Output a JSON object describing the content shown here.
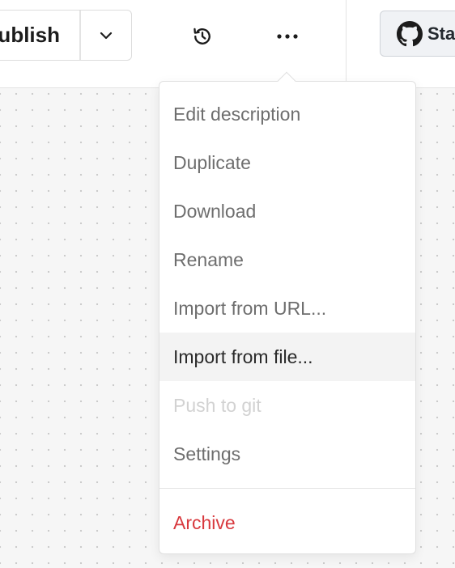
{
  "toolbar": {
    "publish_label": "Publish",
    "star_label": "Star"
  },
  "menu": {
    "items": [
      {
        "label": "Edit description",
        "state": "normal"
      },
      {
        "label": "Duplicate",
        "state": "normal"
      },
      {
        "label": "Download",
        "state": "normal"
      },
      {
        "label": "Rename",
        "state": "normal"
      },
      {
        "label": "Import from URL...",
        "state": "normal"
      },
      {
        "label": "Import from file...",
        "state": "hovered"
      },
      {
        "label": "Push to git",
        "state": "disabled"
      },
      {
        "label": "Settings",
        "state": "normal"
      }
    ],
    "danger_item": {
      "label": "Archive"
    }
  },
  "icons": {
    "dropdown": "chevron-down-icon",
    "history": "history-icon",
    "more": "more-horizontal-icon",
    "github": "github-icon"
  },
  "colors": {
    "danger": "#d8393e",
    "hover_bg": "#f3f3f3",
    "canvas_bg": "#f6f6f6"
  }
}
